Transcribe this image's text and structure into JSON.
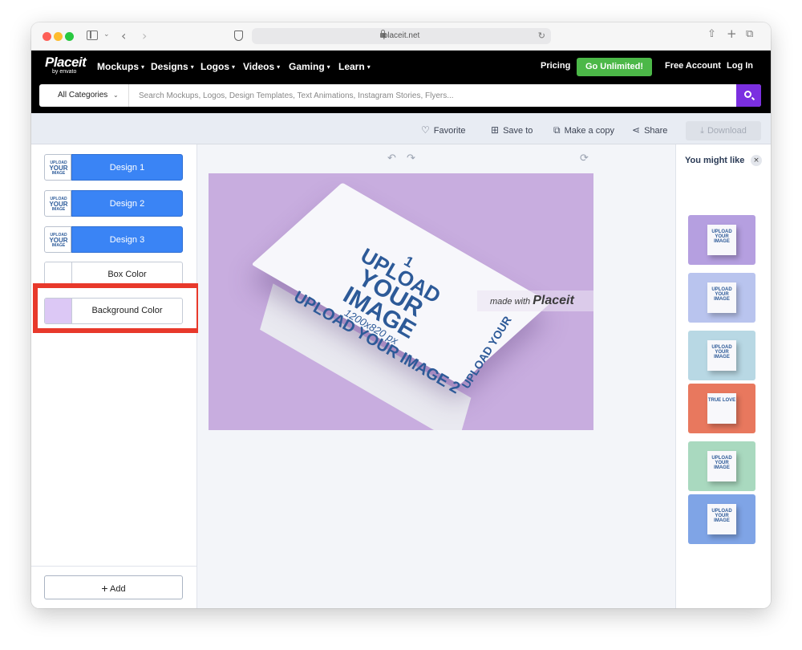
{
  "browser": {
    "url": "placeit.net"
  },
  "nav": {
    "logo": "Placeit",
    "logo_sub": "by envato",
    "items": [
      {
        "label": "Mockups"
      },
      {
        "label": "Designs"
      },
      {
        "label": "Logos"
      },
      {
        "label": "Videos"
      },
      {
        "label": "Gaming"
      },
      {
        "label": "Learn"
      }
    ],
    "pricing": "Pricing",
    "go_unlimited": "Go Unlimited!",
    "free_account": "Free Account",
    "login": "Log In"
  },
  "search": {
    "category": "All Categories",
    "placeholder": "Search Mockups, Logos, Design Templates, Text Animations, Instagram Stories, Flyers..."
  },
  "actions": {
    "favorite": "Favorite",
    "save_to": "Save to",
    "make_copy": "Make a copy",
    "share": "Share",
    "download": "Download"
  },
  "left_panel": {
    "thumb_text": [
      "UPLOAD",
      "YOUR",
      "IMAGE"
    ],
    "designs": [
      {
        "label": "Design 1"
      },
      {
        "label": "Design 2"
      },
      {
        "label": "Design 3"
      }
    ],
    "box_color": {
      "label": "Box Color",
      "swatch": "#ffffff"
    },
    "background_color": {
      "label": "Background Color",
      "swatch": "#dcc8f5"
    },
    "add": "Add"
  },
  "canvas": {
    "background": "#c8addf",
    "box_top_lines": [
      "1",
      "UPLOAD",
      "YOUR",
      "IMAGE",
      "1200x820 px"
    ],
    "box_side_text": "UPLOAD YOUR IMAGE 2",
    "box_end_text": "UPLOAD YOUR",
    "watermark_prefix": "made with",
    "watermark_brand": "Placeit"
  },
  "right_panel": {
    "title": "You might like",
    "close": "×",
    "suggestions": [
      {
        "bg": "#b59fe0",
        "label": "UPLOAD YOUR IMAGE"
      },
      {
        "bg": "#b9c4ee",
        "label": "UPLOAD YOUR IMAGE"
      },
      {
        "bg": "#b8d8e4",
        "label": "UPLOAD YOUR IMAGE"
      },
      {
        "bg": "#e8785e",
        "label": "TRUE LOVE"
      },
      {
        "bg": "#a9d9bf",
        "label": "UPLOAD YOUR IMAGE"
      },
      {
        "bg": "#7fa4e6",
        "label": "UPLOAD YOUR IMAGE"
      }
    ]
  },
  "colors": {
    "accent_blue": "#3a84f5",
    "go_green": "#4cb848",
    "search_purple": "#7b2fe0",
    "highlight_red": "#e8392b"
  }
}
